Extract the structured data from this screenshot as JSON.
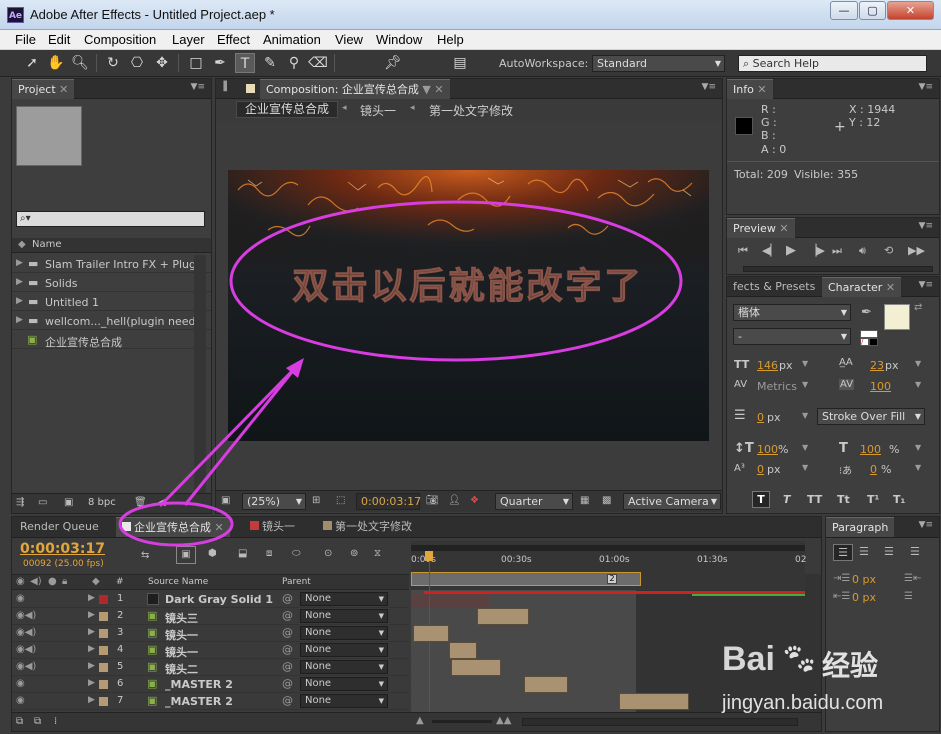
{
  "window": {
    "app_icon": "Ae",
    "title": "Adobe After Effects - Untitled Project.aep *",
    "minimize": "—",
    "maximize": "▢",
    "close": "✕"
  },
  "menu": [
    "File",
    "Edit",
    "Composition",
    "Layer",
    "Effect",
    "Animation",
    "View",
    "Window",
    "Help"
  ],
  "toolbar": {
    "tools": [
      "selection-arrow-icon",
      "hand-icon",
      "zoom-icon",
      "rotate-icon",
      "camera-orbit-icon",
      "pan-behind-icon",
      "rectangle-icon",
      "pen-icon",
      "type-icon",
      "brush-icon",
      "clone-stamp-icon",
      "eraser-icon",
      "puppet-pin-icon"
    ],
    "autoworkspace_label": "AutoWorkspace:",
    "autoworkspace_checked": "✓",
    "workspace": "Standard",
    "search_placeholder": "Search Help"
  },
  "project": {
    "tab": "Project",
    "col_name": "Name",
    "items": [
      {
        "name": "Slam Trailer Intro FX + Plug-in",
        "type": "folder"
      },
      {
        "name": "Solids",
        "type": "folder"
      },
      {
        "name": "Untitled 1",
        "type": "folder"
      },
      {
        "name": "wellcom..._hell(plugin needed)",
        "type": "folder"
      },
      {
        "name": "企业宣传总合成",
        "type": "composition"
      }
    ],
    "bpc": "8 bpc"
  },
  "composition": {
    "tab": "Composition: 企业宣传总合成",
    "breadcrumbs": [
      "企业宣传总合成",
      "镜头一",
      "第一处文字修改"
    ],
    "canvas_text": "双击以后就能改字了",
    "zoom": "(25%)",
    "timecode": "0:00:03:17",
    "resolution": "Quarter",
    "camera": "Active Camera"
  },
  "info": {
    "tab": "Info",
    "r": "R :",
    "g": "G :",
    "b": "B :",
    "a": "A : 0",
    "x": "X : 1944",
    "y": "Y : 12",
    "total": "Total: 209",
    "visible": "Visible: 355"
  },
  "preview": {
    "tab": "Preview",
    "controls": [
      "first-frame-icon",
      "prev-frame-icon",
      "play-icon",
      "next-frame-icon",
      "last-frame-icon",
      "audio-icon",
      "loop-icon",
      "ram-preview-icon"
    ]
  },
  "character": {
    "tab_effects": "fects & Presets",
    "tab": "Character",
    "font": "楷体",
    "style": "-",
    "size": "146",
    "size_unit": "px",
    "leading": "23",
    "leading_unit": "px",
    "kerning": "Metrics",
    "tracking": "100",
    "stroke_width": "0",
    "stroke_unit": "px",
    "stroke_mode": "Stroke Over Fill",
    "vscale": "100",
    "vscale_unit": "%",
    "hscale": "100",
    "hscale_unit": "%",
    "baseline": "0",
    "baseline_unit": "px",
    "tsume": "0",
    "tsume_unit": "%",
    "fill_color": "#f3efd2",
    "styles": [
      "T",
      "T",
      "TT",
      "Tt",
      "T¹",
      "T₁"
    ]
  },
  "paragraph": {
    "tab": "Paragraph",
    "indent1": "0 px",
    "indent2": "0 px"
  },
  "timeline": {
    "tabs": [
      {
        "label": "Render Queue"
      },
      {
        "label": "企业宣传总合成",
        "color": "#e8e8e8"
      },
      {
        "label": "镜头一",
        "color": "#c43b3b"
      },
      {
        "label": "第一处文字修改",
        "color": "#a08d6b"
      }
    ],
    "timecode": "0:00:03:17",
    "frames": "00092 (25.00 fps)",
    "col_num": "#",
    "col_source": "Source Name",
    "col_parent": "Parent",
    "ruler": [
      "0:00s",
      "00:30s",
      "01:00s",
      "01:30s",
      "02"
    ],
    "layers": [
      {
        "num": "1",
        "name": "Dark Gray Solid 1",
        "label_color": "#b0282a",
        "parent": "None",
        "bold": true
      },
      {
        "num": "2",
        "name": "镜头三",
        "label_color": "#b59a74",
        "parent": "None"
      },
      {
        "num": "3",
        "name": "镜头一",
        "label_color": "#b59a74",
        "parent": "None"
      },
      {
        "num": "4",
        "name": "镜头一",
        "label_color": "#b59a74",
        "parent": "None"
      },
      {
        "num": "5",
        "name": "镜头二",
        "label_color": "#b59a74",
        "parent": "None"
      },
      {
        "num": "6",
        "name": "_MASTER 2",
        "label_color": "#b59a74",
        "parent": "None"
      },
      {
        "num": "7",
        "name": "_MASTER 2",
        "label_color": "#b59a74",
        "parent": "None"
      }
    ],
    "marker": "2"
  },
  "watermark": {
    "brand": "Bai",
    "brand2": "经验",
    "url": "jingyan.baidu.com"
  }
}
